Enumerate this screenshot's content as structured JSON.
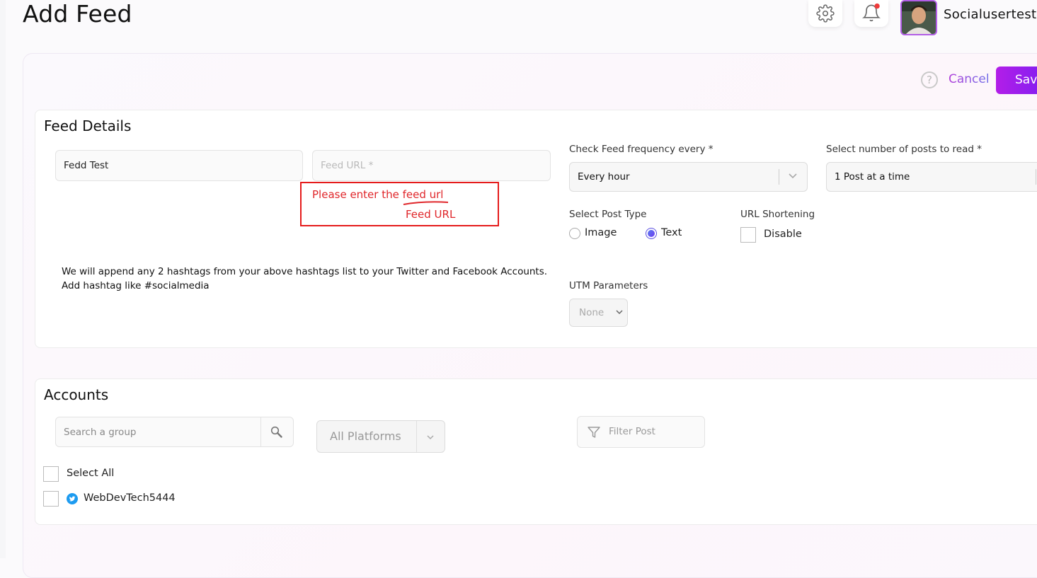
{
  "header": {
    "title": "Add Feed",
    "username": "Socialusertest"
  },
  "icons": {
    "settings": "gear-icon",
    "notifications": "bell-icon",
    "help": "question-icon",
    "search": "search-icon",
    "filter": "filter-icon",
    "twitter": "twitter-icon"
  },
  "colors": {
    "accent": "#9b1ff0",
    "error": "#e0262a",
    "notification_dot": "#ef3b3b",
    "twitter": "#1d9bf0"
  },
  "toolbar": {
    "help_label": "?",
    "cancel_label": "Cancel",
    "save_label": "Save"
  },
  "feed_details": {
    "title": "Feed Details",
    "name_value": "Fedd Test",
    "url_placeholder": "Feed URL *",
    "error_line1": "Please enter the feed url",
    "error_line2": "Feed URL",
    "frequency_label": "Check Feed frequency every *",
    "frequency_value": "Every hour",
    "posts_label": "Select number of posts to read *",
    "posts_value": "1 Post at a time",
    "post_type_label": "Select Post Type",
    "post_type_options": [
      "Image",
      "Text"
    ],
    "post_type_selected": "Text",
    "url_shortening_label": "URL Shortening",
    "url_shortening_option": "Disable",
    "hashtag_note_line1": "We will append any 2 hashtags from your above hashtags list to your Twitter and Facebook Accounts.",
    "hashtag_note_line2": "Add hashtag like #socialmedia",
    "utm_label": "UTM Parameters",
    "utm_value": "None"
  },
  "accounts": {
    "title": "Accounts",
    "search_placeholder": "Search a group",
    "platform_value": "All Platforms",
    "filter_placeholder": "Filter Post",
    "select_all_label": "Select All",
    "items": [
      {
        "name": "WebDevTech5444",
        "platform": "twitter"
      }
    ]
  }
}
